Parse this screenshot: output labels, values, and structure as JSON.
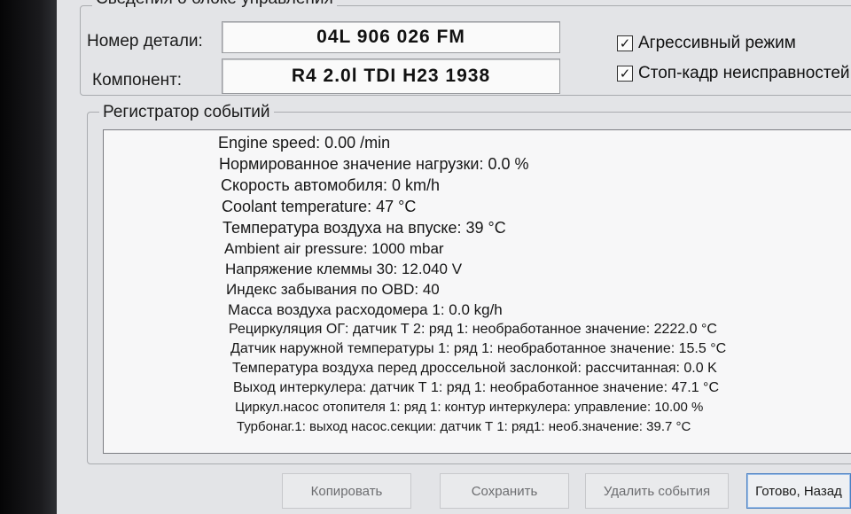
{
  "window": {
    "group_title": "Сведения о блоке управления",
    "part_number_label": "Номер детали:",
    "part_number_value": "04L 906 026 FM",
    "component_label": "Компонент:",
    "component_value": "R4 2.0l TDI   H23 1938",
    "checkboxes": [
      {
        "label": "Агрессивный режим",
        "checked": true,
        "glyph": "✓"
      },
      {
        "label": "Стоп-кадр неисправностей",
        "checked": true,
        "glyph": "✓"
      }
    ]
  },
  "events": {
    "title": "Регистратор событий",
    "lines": [
      "Engine speed: 0.00 /min",
      "Нормированное значение нагрузки: 0.0 %",
      "Скорость автомобиля: 0 km/h",
      "Coolant temperature: 47 °C",
      "Температура воздуха на впуске: 39 °C",
      "Ambient air pressure: 1000 mbar",
      "Напряжение клеммы 30: 12.040 V",
      "Индекс забывания по OBD: 40",
      "Масса воздуха расходомера 1: 0.0 kg/h",
      "Рециркуляция ОГ: датчик Т 2: ряд 1: необработанное значение: 2222.0 °C",
      "Датчик наружной температуры 1: ряд 1: необработанное значение: 15.5 °C",
      "Температура воздуха перед дроссельной заслонкой: рассчитанная: 0.0 K",
      "Выход интеркулера: датчик Т 1: ряд 1: необработанное значение: 47.1 °C",
      "Циркул.насос отопителя 1: ряд 1: контур интеркулера: управление: 10.00 %",
      "Турбонаг.1: выход насос.секции: датчик Т 1: ряд1: необ.значение: 39.7 °C"
    ]
  },
  "buttons": {
    "copy": "Копировать",
    "save": "Сохранить",
    "delete_events": "Удалить события",
    "done_back": "Готово, Назад"
  }
}
